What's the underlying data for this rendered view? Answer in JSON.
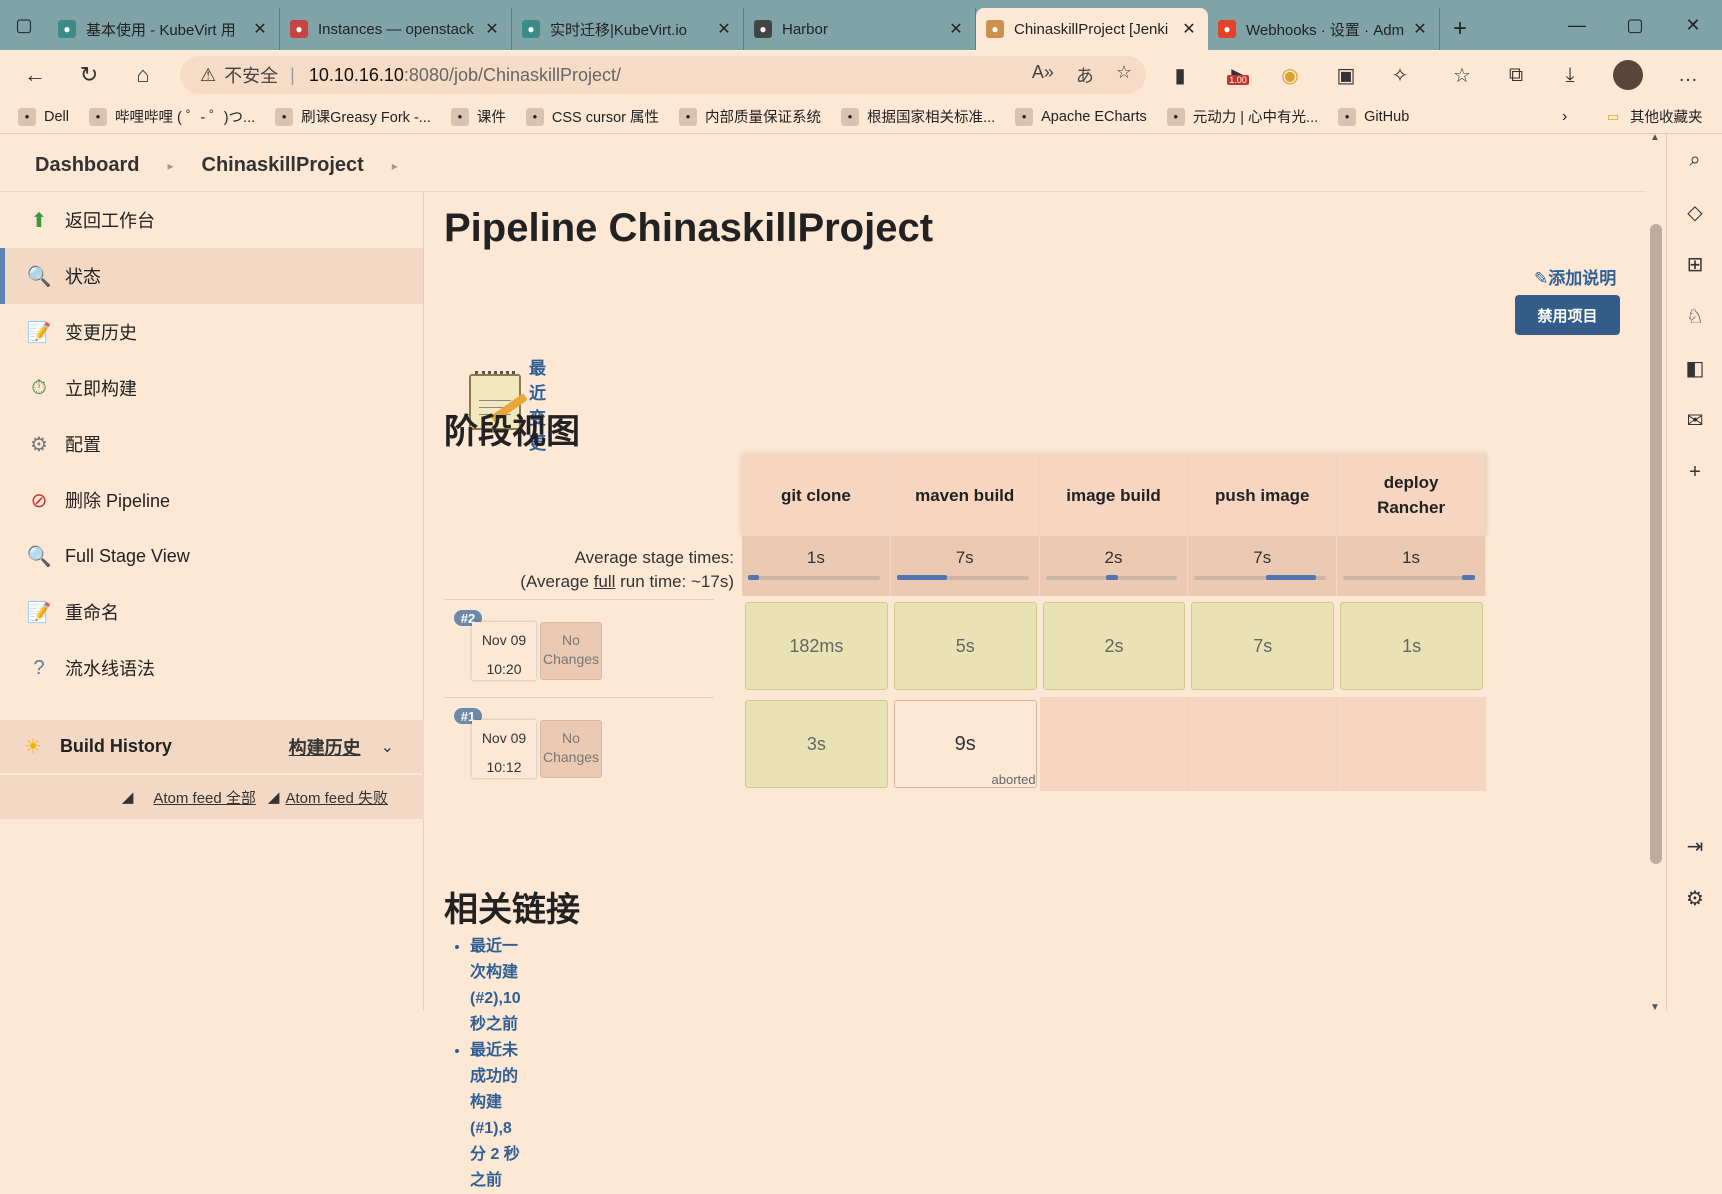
{
  "browser": {
    "tabs": [
      {
        "title": "基本使用 - KubeVirt 用",
        "icon": "kubevirt-icon",
        "color": "#3b8b8b"
      },
      {
        "title": "Instances — openstack",
        "icon": "openstack-icon",
        "color": "#c84444"
      },
      {
        "title": "实时迁移|KubeVirt.io",
        "icon": "kubevirt-icon",
        "color": "#3b8b8b"
      },
      {
        "title": "Harbor",
        "icon": "harbor-icon",
        "color": "#444"
      },
      {
        "title": "ChinaskillProject [Jenki",
        "icon": "jenkins-icon",
        "color": "#c9914a"
      },
      {
        "title": "Webhooks · 设置 · Adm",
        "icon": "gitlab-icon",
        "color": "#e24329"
      }
    ],
    "address": {
      "insecure_label": "不安全",
      "host": "10.10.16.10",
      "path": ":8080/job/ChinaskillProject/"
    },
    "ext_badge": "1.00",
    "bookmarks": [
      {
        "label": "Dell",
        "icon": "folder-icon"
      },
      {
        "label": "哔哩哔哩 ( ゜- ゜)つ...",
        "icon": "bilibili-icon"
      },
      {
        "label": "刷课Greasy Fork -...",
        "icon": "greasyfork-icon"
      },
      {
        "label": "课件",
        "icon": "courseware-icon"
      },
      {
        "label": "CSS cursor 属性",
        "icon": "runoob-icon"
      },
      {
        "label": "内部质量保证系统",
        "icon": "quality-icon"
      },
      {
        "label": "根据国家相关标准...",
        "icon": "star-icon"
      },
      {
        "label": "Apache ECharts",
        "icon": "echarts-icon"
      },
      {
        "label": "元动力 | 心中有光...",
        "icon": "yuandongli-icon"
      },
      {
        "label": "GitHub",
        "icon": "github-icon"
      }
    ],
    "other_bookmarks": "其他收藏夹"
  },
  "breadcrumb": {
    "dashboard": "Dashboard",
    "project": "ChinaskillProject"
  },
  "sidebar": {
    "items": [
      {
        "label": "返回工作台",
        "icon": "up-arrow-icon"
      },
      {
        "label": "状态",
        "icon": "magnifier-icon"
      },
      {
        "label": "变更历史",
        "icon": "notepad-icon"
      },
      {
        "label": "立即构建",
        "icon": "build-clock-icon"
      },
      {
        "label": "配置",
        "icon": "gear-icon"
      },
      {
        "label": "删除 Pipeline",
        "icon": "no-entry-icon"
      },
      {
        "label": "Full Stage View",
        "icon": "magnifier-icon"
      },
      {
        "label": "重命名",
        "icon": "notepad-icon"
      },
      {
        "label": "流水线语法",
        "icon": "help-icon"
      }
    ],
    "build_history": {
      "label": "Build History",
      "cn_label": "构建历史"
    },
    "feeds": {
      "all": "Atom feed 全部",
      "failed": "Atom feed 失败"
    }
  },
  "main": {
    "title": "Pipeline ChinaskillProject",
    "add_description": "添加说明",
    "disable_button": "禁用项目",
    "recent_changes": "最近变更",
    "stage_view_title": "阶段视图",
    "related_links_title": "相关链接"
  },
  "stage_view": {
    "stages": [
      "git clone",
      "maven build",
      "image build",
      "push image",
      "deploy Rancher"
    ],
    "avg_label_line1": "Average stage times:",
    "avg_label_prefix": "(Average ",
    "avg_label_full": "full",
    "avg_label_suffix": " run time: ~17s)",
    "avg_times": [
      "1s",
      "7s",
      "2s",
      "7s",
      "1s"
    ],
    "avg_bar": [
      {
        "start": 0.0,
        "end": 0.08
      },
      {
        "start": 0.0,
        "end": 0.38
      },
      {
        "start": 0.46,
        "end": 0.55
      },
      {
        "start": 0.54,
        "end": 0.92
      },
      {
        "start": 0.9,
        "end": 1.0
      }
    ],
    "runs": [
      {
        "badge": "#2",
        "date": "Nov 09",
        "time": "10:20",
        "changes": "No Changes",
        "cells": [
          {
            "text": "182ms",
            "status": "ok"
          },
          {
            "text": "5s",
            "status": "ok"
          },
          {
            "text": "2s",
            "status": "ok"
          },
          {
            "text": "7s",
            "status": "ok"
          },
          {
            "text": "1s",
            "status": "ok"
          }
        ]
      },
      {
        "badge": "#1",
        "date": "Nov 09",
        "time": "10:12",
        "changes": "No Changes",
        "cells": [
          {
            "text": "3s",
            "status": "ok"
          },
          {
            "text": "9s",
            "status": "aborted",
            "note": "aborted"
          },
          {
            "text": "",
            "status": "empty"
          },
          {
            "text": "",
            "status": "empty"
          },
          {
            "text": "",
            "status": "empty"
          }
        ]
      }
    ]
  },
  "related_links": [
    "最近一次构建(#2),10 秒之前",
    "最近未成功的构建(#1),8 分 2 秒之前"
  ]
}
